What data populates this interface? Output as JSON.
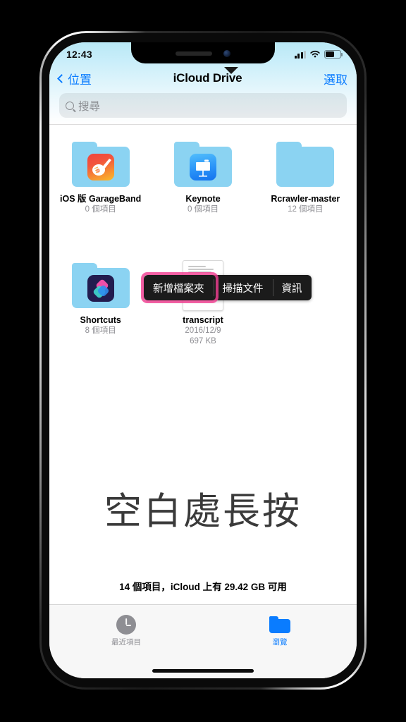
{
  "status_bar": {
    "time": "12:43",
    "signal_icon": "cellular-signal-icon",
    "wifi_icon": "wifi-icon",
    "battery_icon": "battery-icon"
  },
  "nav": {
    "back_label": "位置",
    "title": "iCloud Drive",
    "select_label": "選取"
  },
  "search": {
    "placeholder": "搜尋",
    "value": ""
  },
  "files": [
    {
      "name": "iOS 版 GarageBand",
      "meta": "0 個項目",
      "kind": "folder",
      "app_icon": "garageband-icon"
    },
    {
      "name": "Keynote",
      "meta": "0 個項目",
      "kind": "folder",
      "app_icon": "keynote-icon"
    },
    {
      "name": "Rcrawler-master",
      "meta": "12 個項目",
      "kind": "folder",
      "app_icon": ""
    },
    {
      "name": "Shortcuts",
      "meta": "8 個項目",
      "kind": "folder",
      "app_icon": "shortcuts-icon"
    },
    {
      "name": "transcript",
      "meta": "2016/12/9",
      "meta2": "697 KB",
      "kind": "document",
      "app_icon": "document-thumbnail"
    }
  ],
  "context_menu": {
    "items": [
      {
        "label": "新增檔案夾",
        "highlighted": true
      },
      {
        "label": "掃描文件",
        "highlighted": false
      },
      {
        "label": "資訊",
        "highlighted": false
      }
    ],
    "highlight_color": "#f13f93",
    "background_color": "#1b1b1b"
  },
  "annotation": {
    "text": "空白處長按"
  },
  "footer": {
    "status": "14 個項目，iCloud 上有 29.42 GB 可用"
  },
  "tab_bar": {
    "tabs": [
      {
        "label": "最近項目",
        "icon": "clock-icon",
        "active": false
      },
      {
        "label": "瀏覽",
        "icon": "folder-icon",
        "active": true
      }
    ],
    "active_color": "#0a7cff",
    "inactive_color": "#8e8e93"
  }
}
